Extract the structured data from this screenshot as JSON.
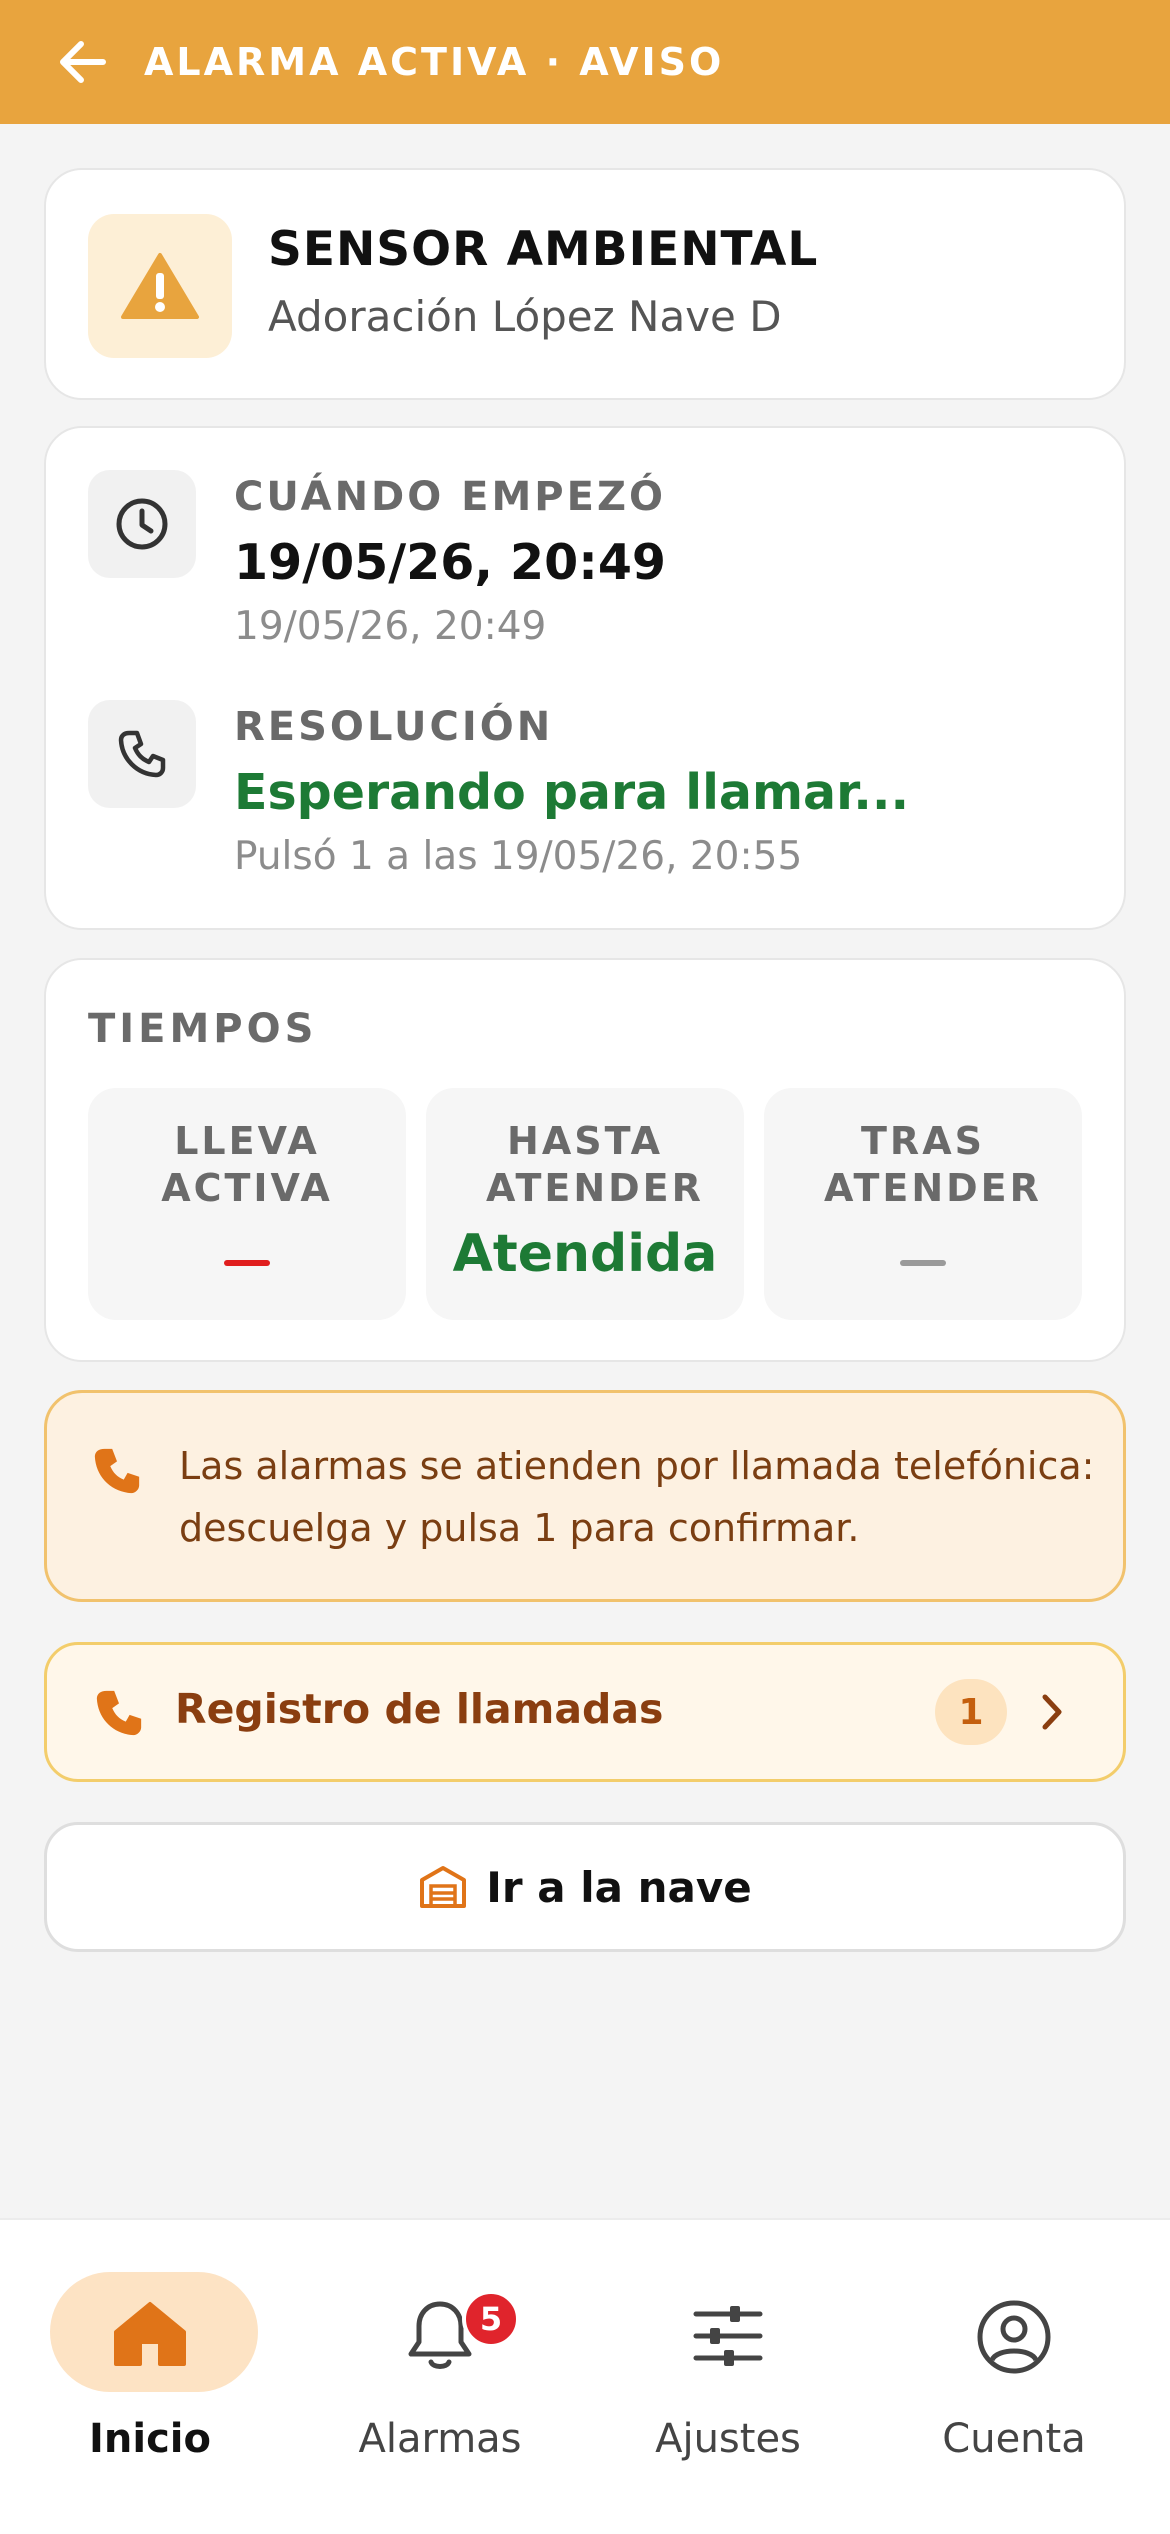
{
  "appbar": {
    "title": "ALARMA ACTIVA · AVISO"
  },
  "sensor": {
    "title": "SENSOR AMBIENTAL",
    "subtitle": "Adoración López Nave D"
  },
  "started": {
    "label": "CUÁNDO EMPEZÓ",
    "value": "19/05/26, 20:49",
    "sub": "19/05/26, 20:49"
  },
  "resolution": {
    "label": "RESOLUCIÓN",
    "value": "Esperando para llamar...",
    "sub": "Pulsó 1 a las 19/05/26, 20:55"
  },
  "tiempos": {
    "title": "TIEMPOS",
    "boxes": [
      {
        "label": "LLEVA ACTIVA",
        "value": ""
      },
      {
        "label": "HASTA ATENDER",
        "value": "Atendida"
      },
      {
        "label": "TRAS ATENDER",
        "value": ""
      }
    ]
  },
  "notice": {
    "text": "Las alarmas se atienden por llamada telefónica: descuelga y pulsa 1 para confirmar."
  },
  "calls": {
    "label": "Registro de llamadas",
    "count": "1"
  },
  "go": {
    "label": "Ir a la nave"
  },
  "nav": {
    "items": [
      {
        "label": "Inicio",
        "icon": "home-icon",
        "active": true
      },
      {
        "label": "Alarmas",
        "icon": "bell-icon",
        "badge": "5"
      },
      {
        "label": "Ajustes",
        "icon": "sliders-icon"
      },
      {
        "label": "Cuenta",
        "icon": "account-icon"
      }
    ]
  },
  "colors": {
    "appbar": "#e8a43e",
    "accent_green": "#1d7a35",
    "alert_red": "#e01e1e",
    "notice_bg": "#fdf1e1",
    "notice_text": "#7a3e12"
  }
}
